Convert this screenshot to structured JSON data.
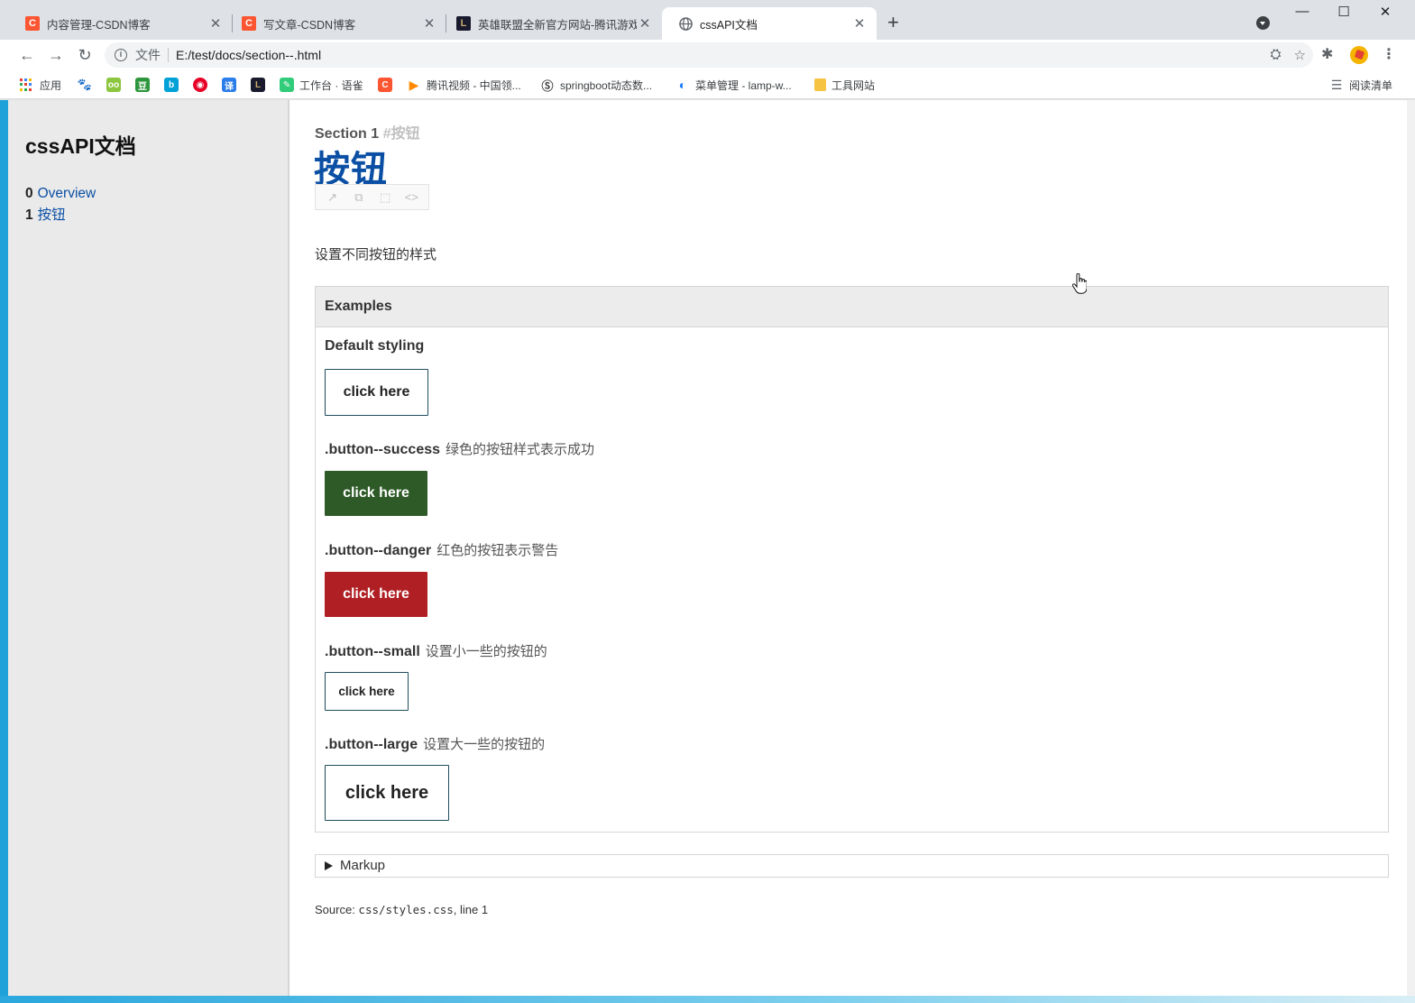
{
  "browser": {
    "tabs": [
      {
        "title": "内容管理-CSDN博客",
        "favicon": "C",
        "color": "#fc5531",
        "active": false
      },
      {
        "title": "写文章-CSDN博客",
        "favicon": "C",
        "color": "#fc5531",
        "active": false
      },
      {
        "title": "英雄联盟全新官方网站-腾讯游戏",
        "favicon": "L",
        "color": "#1a1a2e",
        "active": false
      },
      {
        "title": "cssAPI文档",
        "favicon": "globe",
        "color": "#5f6368",
        "active": true
      }
    ],
    "new_tab_label": "+",
    "window": {
      "minimize": "—",
      "maximize": "☐",
      "close": "✕"
    },
    "address": {
      "scheme_label": "文件",
      "url": "E:/test/docs/section--.html"
    },
    "bookmarks": [
      {
        "label": "应用",
        "icon": "apps-grid-icon"
      },
      {
        "label": "",
        "icon": "baidu-paw-icon",
        "color": "#2932e1",
        "glyph": "🐾"
      },
      {
        "label": "",
        "icon": "iqiyi-icon",
        "color": "#8cc63f",
        "glyph": "oo"
      },
      {
        "label": "",
        "icon": "douban-icon",
        "color": "#2e963d",
        "glyph": "豆"
      },
      {
        "label": "",
        "icon": "bilibili-icon",
        "color": "#00a1d6",
        "glyph": "b"
      },
      {
        "label": "",
        "icon": "netease-music-icon",
        "color": "#e60026",
        "glyph": "◉"
      },
      {
        "label": "",
        "icon": "translate-icon",
        "color": "#2b7de9",
        "glyph": "译"
      },
      {
        "label": "",
        "icon": "lol-icon",
        "color": "#1a1a2e",
        "glyph": "L"
      },
      {
        "label": "工作台 · 语雀",
        "icon": "yuque-icon",
        "color": "#31cc79",
        "glyph": "✎"
      },
      {
        "label": "",
        "icon": "csdn-icon",
        "color": "#fc5531",
        "glyph": "C"
      },
      {
        "label": "腾讯视频 - 中国领...",
        "icon": "tencent-video-icon",
        "color": "#ff8a00",
        "glyph": "▶"
      },
      {
        "label": "springboot动态数...",
        "icon": "springboot-icon",
        "color": "#444",
        "glyph": "Ⓢ"
      },
      {
        "label": "菜单管理 - lamp-w...",
        "icon": "lamp-icon",
        "color": "#1677ff",
        "glyph": "◐"
      },
      {
        "label": "工具网站",
        "icon": "folder-icon",
        "color": "#f6c343",
        "glyph": ""
      }
    ],
    "reading_list": "阅读清单"
  },
  "sidebar": {
    "title": "cssAPI文档",
    "items": [
      {
        "num": "0",
        "label": "Overview"
      },
      {
        "num": "1",
        "label": "按钮"
      }
    ]
  },
  "section": {
    "label": "Section 1",
    "anchor": "#按钮",
    "title": "按钮",
    "tools": [
      "↗",
      "⧉",
      "⬚",
      "<>"
    ],
    "description": "设置不同按钮的样式"
  },
  "examples": {
    "header": "Examples",
    "items": [
      {
        "label": "Default styling",
        "note": "",
        "button": "click here",
        "bg": "#ffffff",
        "fg": "#222222"
      },
      {
        "label": ".button--success",
        "note": "绿色的按钮样式表示成功",
        "button": "click here",
        "bg": "#2d5a27",
        "fg": "#ffffff"
      },
      {
        "label": ".button--danger",
        "note": "红色的按钮表示警告",
        "button": "click here",
        "bg": "#b01f24",
        "fg": "#ffffff"
      },
      {
        "label": ".button--small",
        "note": "设置小一些的按钮的",
        "button": "click here",
        "bg": "#ffffff",
        "fg": "#222222"
      },
      {
        "label": ".button--large",
        "note": "设置大一些的按钮的",
        "button": "click here",
        "bg": "#ffffff",
        "fg": "#222222"
      }
    ]
  },
  "markup_label": "Markup",
  "source": {
    "prefix": "Source: ",
    "file": "css/styles.css",
    "suffix": ", line 1"
  }
}
